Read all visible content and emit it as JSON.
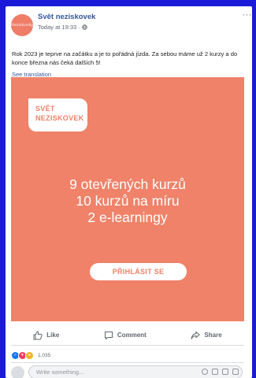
{
  "post": {
    "page_name": "Svět neziskovek",
    "timestamp": "Today at 19:33 · ",
    "more_label": "···",
    "avatar_text": "Neziskovky",
    "text": "Rok 2023 je teprve na začátku a je to pořádná jízda. Za sebou máme už 2 kurzy a do konce března nás čeká dalších 5!",
    "see_translation": "See translation"
  },
  "image": {
    "logo_line1": "SVĚT",
    "logo_line2": "NEZISKOVEK",
    "headline": [
      "9 otevřených kurzů",
      "10 kurzů na míru",
      "2 e-learningy"
    ],
    "cta_label": "PŘIHLÁSIT SE",
    "background_color": "#ef8269"
  },
  "actions": {
    "like": "Like",
    "comment": "Comment",
    "share": "Share"
  },
  "reactions": {
    "count": "1.035"
  },
  "comment_box": {
    "placeholder": "Write something..."
  }
}
